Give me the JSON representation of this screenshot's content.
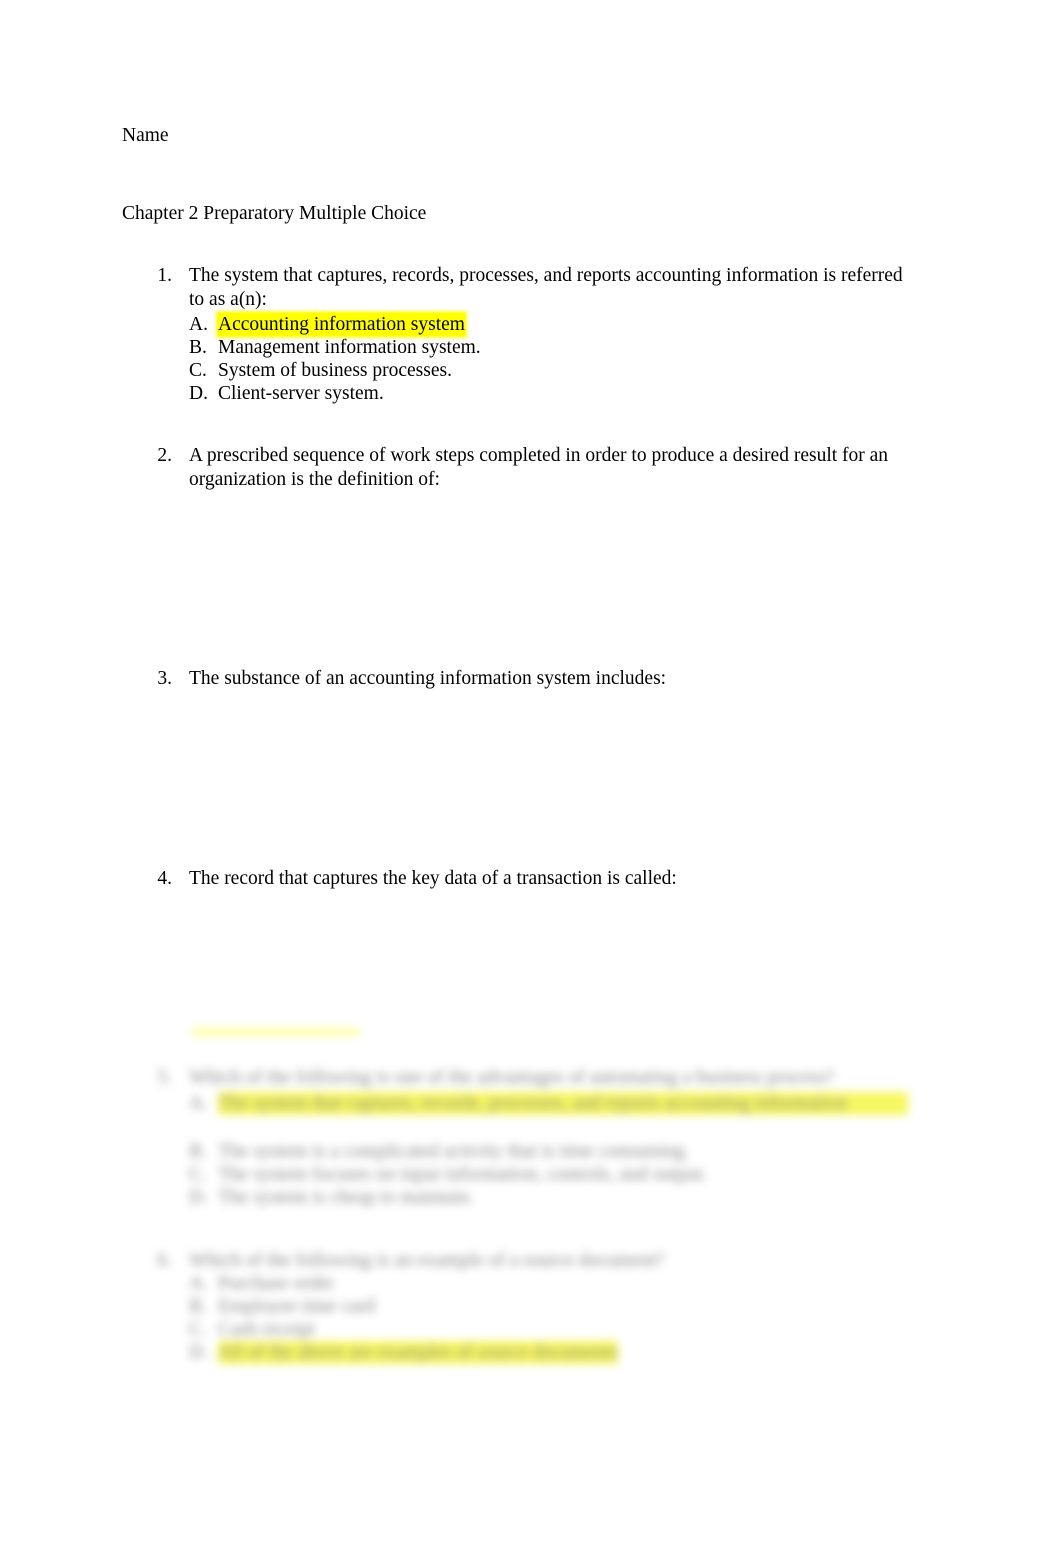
{
  "document": {
    "name_label": "Name",
    "title": "Chapter 2 Preparatory Multiple Choice",
    "highlight_color": "#ffff00",
    "text_color": "#000000",
    "page_background": "#ffffff"
  },
  "questions": [
    {
      "number": "1.",
      "stem": "The system that captures, records, processes, and reports accounting information is referred to as a(n):",
      "choices": [
        {
          "letter": "A.",
          "text": "Accounting information system",
          "highlighted": true
        },
        {
          "letter": "B.",
          "text": "Management information system.",
          "highlighted": false
        },
        {
          "letter": "C.",
          "text": "System of business processes.",
          "highlighted": false
        },
        {
          "letter": "D.",
          "text": "Client-server system.",
          "highlighted": false
        }
      ]
    },
    {
      "number": "2.",
      "stem": "A prescribed sequence of work steps completed in order to produce a desired result for an organization is the definition of:",
      "choices": []
    },
    {
      "number": "3.",
      "stem": "The substance of an accounting information system includes:",
      "choices": []
    },
    {
      "number": "4.",
      "stem": "The record that captures the key data of a transaction is called:",
      "choices": []
    },
    {
      "number": "5.",
      "stem": "Which of the following is one of the advantages of automating a business process?",
      "blurred": true,
      "choices": [
        {
          "letter": "A.",
          "text": "The system that captures, records, processes, and reports accounting information",
          "highlighted": true
        },
        {
          "letter": "B.",
          "text": "The system is a complicated activity that is time consuming.",
          "highlighted": false
        },
        {
          "letter": "C.",
          "text": "The system focuses on input information, controls, and output.",
          "highlighted": false
        },
        {
          "letter": "D.",
          "text": "The system is cheap to maintain.",
          "highlighted": false
        }
      ]
    },
    {
      "number": "6.",
      "stem": "Which of the following is an example of a source document?",
      "blurred": true,
      "choices": [
        {
          "letter": "A.",
          "text": "Purchase order",
          "highlighted": false
        },
        {
          "letter": "B.",
          "text": "Employee time card",
          "highlighted": false
        },
        {
          "letter": "C.",
          "text": "Cash receipt",
          "highlighted": false
        },
        {
          "letter": "D.",
          "text": "All of the above are examples of source documents",
          "highlighted": true
        }
      ]
    }
  ]
}
